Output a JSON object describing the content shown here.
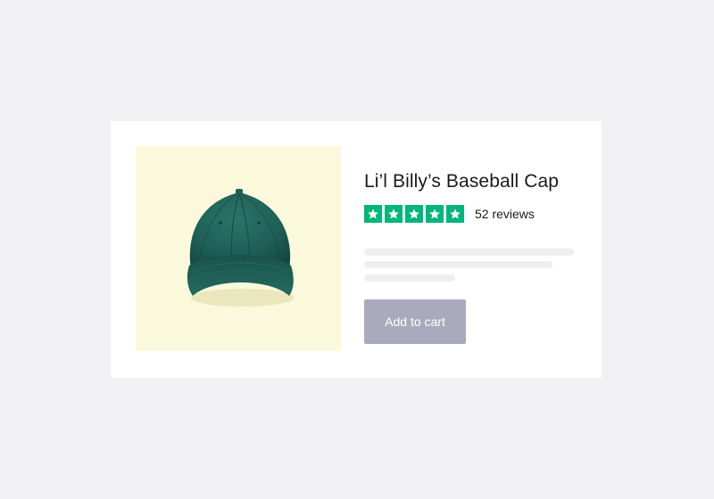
{
  "product": {
    "title": "Li’l Billy’s Baseball Cap",
    "image_alt": "green-baseball-cap",
    "image_background": "#faf9dc",
    "cap_color": "#1f5f57"
  },
  "rating": {
    "stars": 5,
    "max_stars": 5,
    "reviews_label": "52 reviews",
    "star_color": "#00b67a"
  },
  "actions": {
    "add_to_cart_label": "Add to cart",
    "add_to_cart_color": "#aaaabe"
  }
}
